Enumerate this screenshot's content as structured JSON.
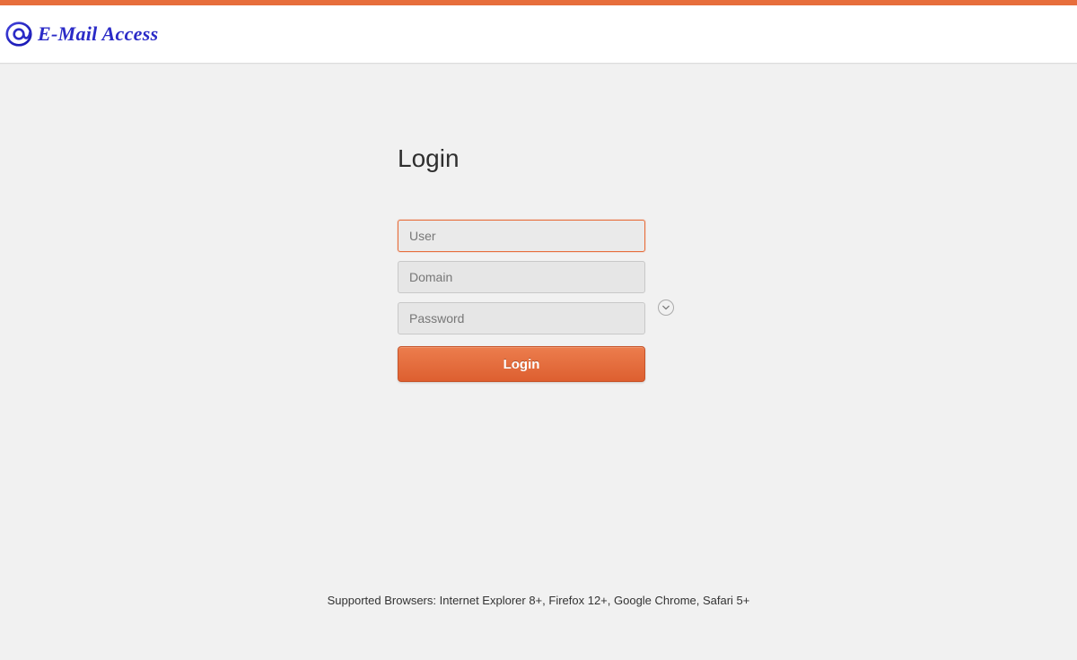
{
  "header": {
    "logo_text": "E-Mail Access"
  },
  "login": {
    "title": "Login",
    "user_placeholder": "User",
    "user_value": "",
    "domain_placeholder": "Domain",
    "domain_value": "",
    "password_placeholder": "Password",
    "password_value": "",
    "button_label": "Login"
  },
  "footer": {
    "supported_text": "Supported Browsers: Internet Explorer 8+, Firefox 12+, Google Chrome, Safari 5+"
  },
  "colors": {
    "accent": "#e76e3c",
    "logo_blue": "#2b2bc7"
  }
}
